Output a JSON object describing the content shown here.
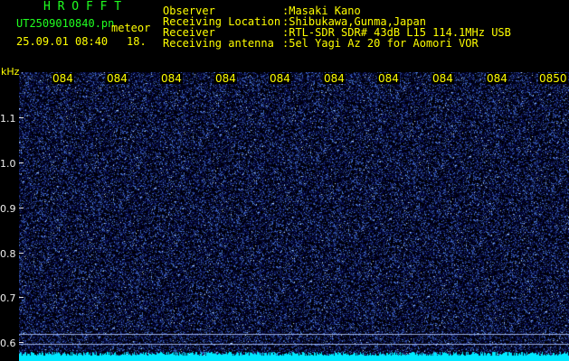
{
  "app_title": "H R O F F T",
  "file_name": "UT2509010840.pn",
  "meteor_label": "meteor",
  "datetime": "25.09.01 08:40",
  "count": "18.",
  "info": {
    "observer_label": "Observer",
    "observer_value": ":Masaki Kano",
    "location_label": "Receiving Location",
    "location_value": ":Shibukawa,Gunma,Japan",
    "receiver_label": "Receiver",
    "receiver_value": ":RTL-SDR SDR# 43dB L15 114.1MHz USB",
    "antenna_label": "Receiving antenna",
    "antenna_value": ":5el Yagi Az 20 for Aomori VOR"
  },
  "y_axis": {
    "unit": "kHz",
    "ticks": [
      "1.1",
      "1.0",
      "0.9",
      "0.8",
      "0.7",
      "0.6"
    ]
  },
  "time_axis": {
    "labels": [
      "084",
      "084",
      "084",
      "084",
      "084",
      "084",
      "084",
      "084",
      "084",
      "0850"
    ]
  },
  "colors": {
    "background": "#000000",
    "noise_low": "#0a1a7a",
    "noise_high": "#5aa0ff",
    "header_green": "#20ff20",
    "header_yellow": "#ffff00",
    "baseline_cyan": "#00e8ff"
  }
}
